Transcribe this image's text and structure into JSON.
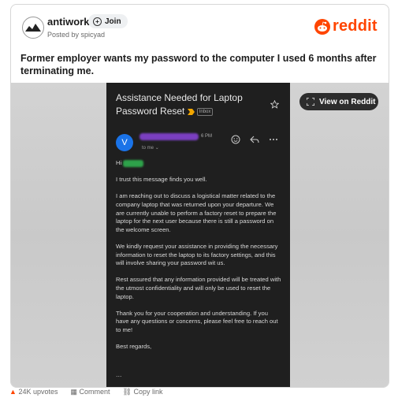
{
  "post": {
    "subreddit": "antiwork",
    "join_label": "Join",
    "posted_by": "Posted by spicyad",
    "title": "Former employer wants my password to the computer I used 6 months after terminating me.",
    "brand": "reddit",
    "view_label": "View on Reddit"
  },
  "email": {
    "subject": "Assistance Needed for Laptop Password Reset",
    "inbox_tag": "Inbox",
    "sender_initial": "V",
    "time": "6 PM",
    "to_me": "to me",
    "greeting": "Hi",
    "paragraphs": [
      "I trust this message finds you well.",
      "I am reaching out to discuss a logistical matter related to the company laptop that was returned upon your departure. We are currently unable to perform a factory reset to prepare the laptop for the next user because there is still a password on the welcome screen.",
      "We kindly request your assistance in providing the necessary information to reset the laptop to its factory settings, and this will involve sharing your password wit us.",
      "Rest assured that any information provided will be treated with the utmost confidentiality and will only be used to reset the laptop.",
      "Thank you for your cooperation and understanding. If you have any questions or concerns, please feel free to reach out to me!",
      "Best regards,"
    ],
    "more": "..."
  },
  "footer": {
    "upvotes": "24K upvotes",
    "comment": "Comment",
    "copy_link": "Copy link"
  },
  "colors": {
    "brand": "#ff4500",
    "email_bg": "#1f1f1f",
    "sender_avatar": "#1a73e8"
  }
}
